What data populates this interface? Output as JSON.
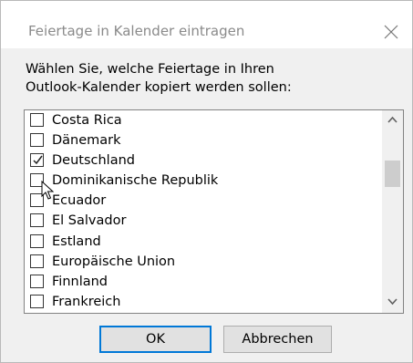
{
  "dialog": {
    "title": "Feiertage in Kalender eintragen",
    "close_icon": "close-icon"
  },
  "prompt": {
    "line1": "Wählen Sie, welche Feiertage in Ihren",
    "line2": "Outlook-Kalender kopiert werden sollen:"
  },
  "countries": [
    {
      "label": "Costa Rica",
      "checked": false
    },
    {
      "label": "Dänemark",
      "checked": false
    },
    {
      "label": "Deutschland",
      "checked": true
    },
    {
      "label": "Dominikanische Republik",
      "checked": false
    },
    {
      "label": "Ecuador",
      "checked": false
    },
    {
      "label": "El Salvador",
      "checked": false
    },
    {
      "label": "Estland",
      "checked": false
    },
    {
      "label": "Europäische Union",
      "checked": false
    },
    {
      "label": "Finnland",
      "checked": false
    },
    {
      "label": "Frankreich",
      "checked": false
    }
  ],
  "scrollbar": {
    "up_icon": "chevron-up-icon",
    "down_icon": "chevron-down-icon"
  },
  "buttons": {
    "ok": "OK",
    "cancel": "Abbrechen"
  },
  "colors": {
    "title_text": "#8a8a8a",
    "body_bg": "#f0f0f0",
    "button_bg": "#e1e1e1",
    "default_button_border": "#0078d7",
    "scroll_thumb": "#cdcdcd"
  }
}
